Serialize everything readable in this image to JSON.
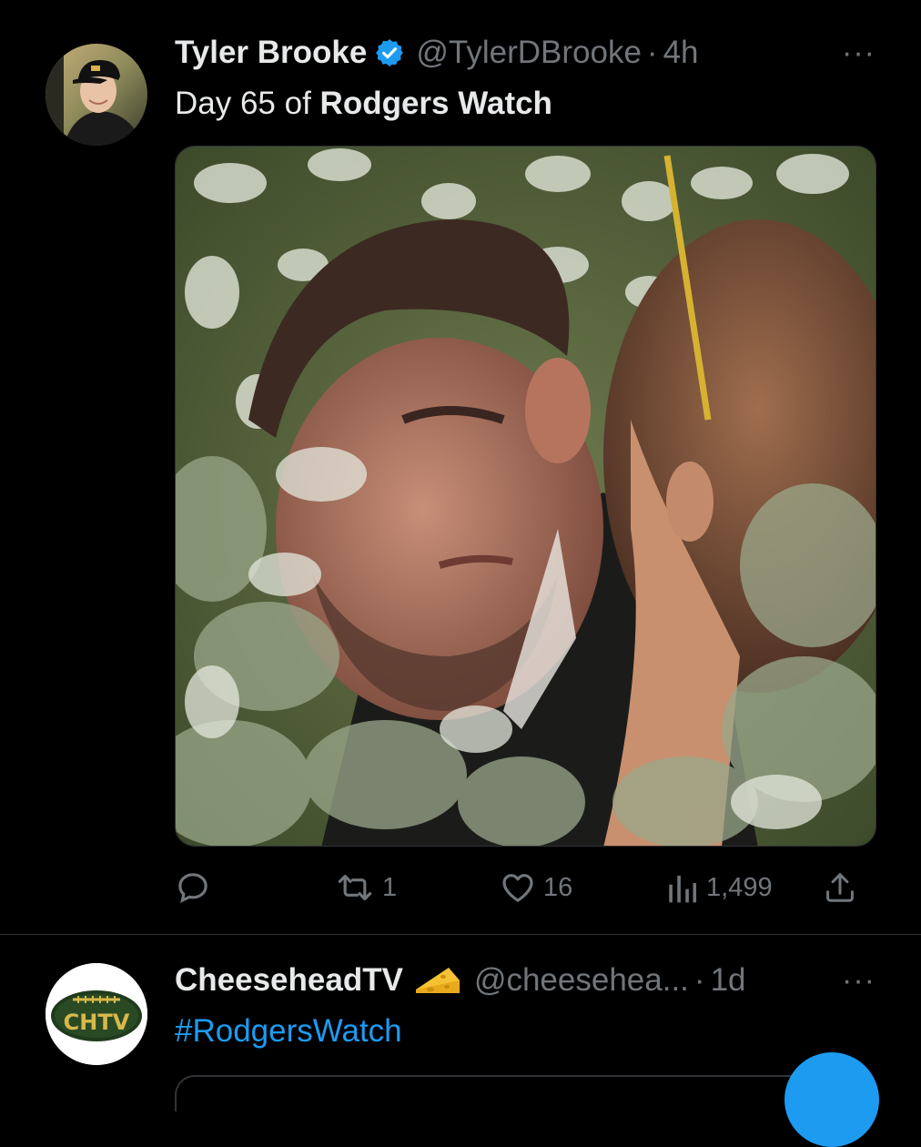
{
  "tweets": [
    {
      "display_name": "Tyler Brooke",
      "verified": true,
      "handle": "@TylerDBrooke",
      "separator": "·",
      "time": "4h",
      "more": "···",
      "text_plain": "Day 65 of ",
      "text_bold": "Rodgers Watch",
      "media": {
        "type": "photo",
        "description": ""
      },
      "actions": {
        "reply_icon": "reply-icon",
        "retweets": "1",
        "likes": "16",
        "views": "1,499",
        "share_icon": "share-icon"
      }
    },
    {
      "display_name": "CheeseheadTV",
      "name_emoji": "cheese-icon",
      "handle": "@cheesehea...",
      "separator": "·",
      "time": "1d",
      "more": "···",
      "text_hashtag": "#RodgersWatch",
      "avatar_logo_text": "CHTV"
    }
  ],
  "colors": {
    "background": "#000000",
    "text": "#e7e9ea",
    "muted": "#71767b",
    "link": "#1d9bf0",
    "verified": "#1d9bf0",
    "divider": "#2f3336"
  }
}
